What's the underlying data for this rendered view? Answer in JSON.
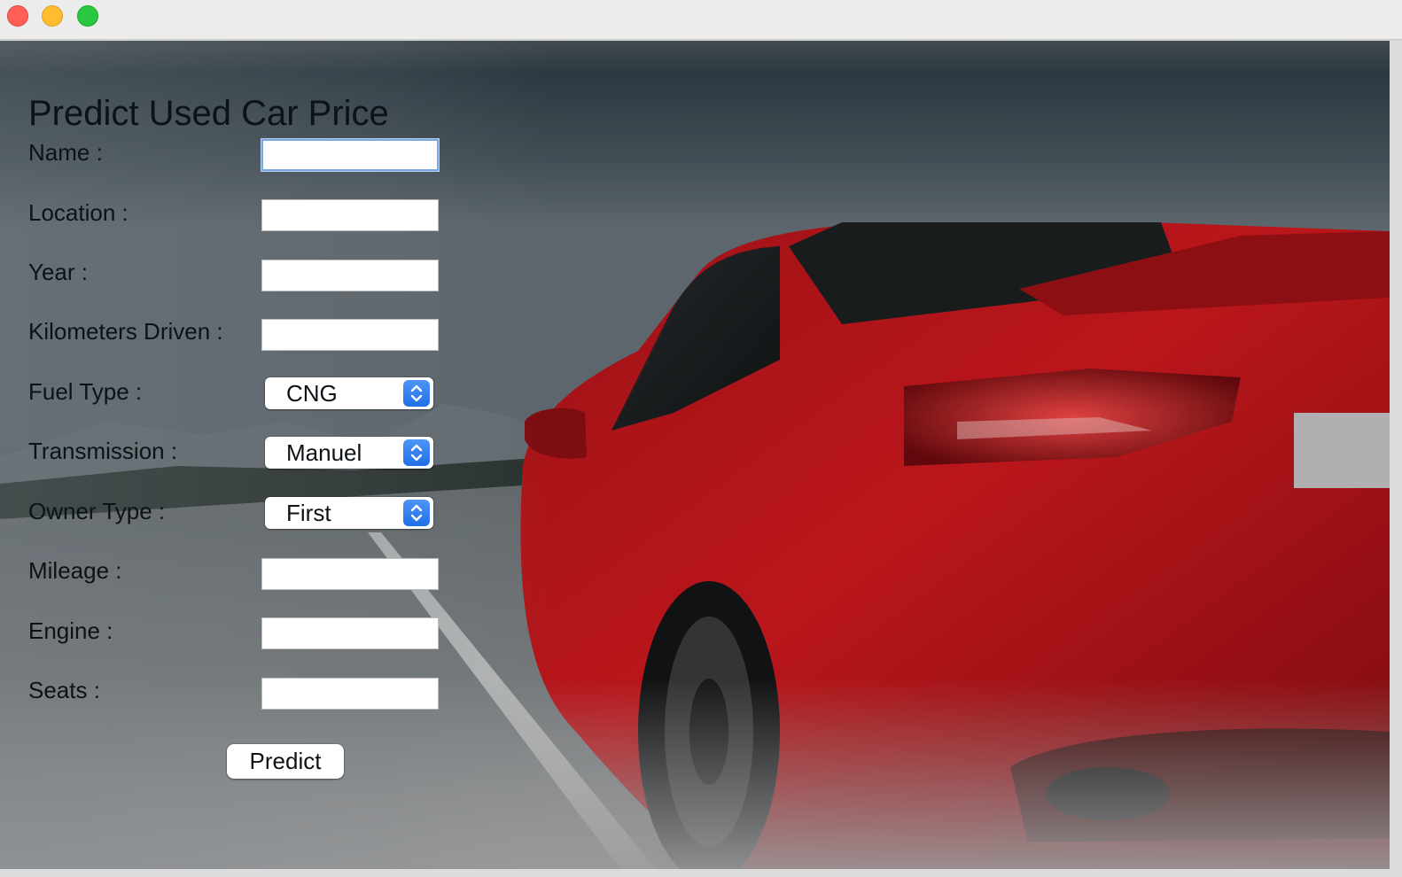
{
  "form": {
    "title": "Predict Used Car Price",
    "labels": {
      "name": "Name :",
      "location": "Location :",
      "year": "Year :",
      "kilometers": "Kilometers Driven :",
      "fuel_type": "Fuel Type :",
      "transmission": "Transmission :",
      "owner_type": "Owner Type :",
      "mileage": "Mileage :",
      "engine": "Engine :",
      "seats": "Seats :"
    },
    "values": {
      "name": "",
      "location": "",
      "year": "",
      "kilometers": "",
      "mileage": "",
      "engine": "",
      "seats": ""
    },
    "selects": {
      "fuel_type": "CNG",
      "transmission": "Manuel",
      "owner_type": "First"
    },
    "predict_label": "Predict"
  },
  "colors": {
    "car_red": "#c0141a",
    "select_accent": "#2a7af0"
  }
}
